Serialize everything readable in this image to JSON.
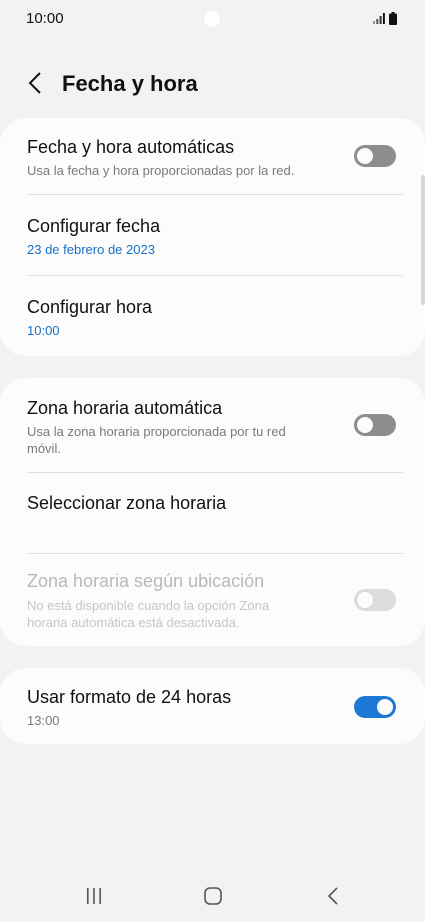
{
  "status_bar": {
    "time": "10:00"
  },
  "header": {
    "title": "Fecha y hora"
  },
  "card_date_time": {
    "auto_date_time": {
      "title": "Fecha y hora automáticas",
      "summary": "Usa la fecha y hora proporcionadas por la red.",
      "toggle": "off"
    },
    "set_date": {
      "title": "Configurar fecha",
      "value": "23 de febrero de 2023"
    },
    "set_time": {
      "title": "Configurar hora",
      "value": "10:00"
    }
  },
  "card_time_zone": {
    "auto_time_zone": {
      "title": "Zona horaria automática",
      "summary_line1": "Usa la zona horaria proporcionada por tu red",
      "summary_line2": "móvil.",
      "toggle": "off"
    },
    "select_time_zone": {
      "title": "Seleccionar zona horaria"
    },
    "location_time_zone": {
      "title": "Zona horaria según ubicación",
      "summary_line1": "No está disponible cuando la opción Zona",
      "summary_line2": "horaria automática está desactivada.",
      "toggle": "off",
      "enabled": false
    }
  },
  "card_format": {
    "use_24h": {
      "title": "Usar formato de 24 horas",
      "value": "13:00",
      "toggle": "on"
    }
  },
  "colors": {
    "accent": "#1f78d6",
    "value_text": "#1a6fc4",
    "background": "#f2f2f2",
    "card": "#fcfcfc"
  },
  "icons": {
    "back": "chevron-left-icon",
    "signal": "signal-icon",
    "battery": "battery-icon",
    "nav_recents": "recents-icon",
    "nav_home": "home-icon",
    "nav_back": "back-icon"
  }
}
